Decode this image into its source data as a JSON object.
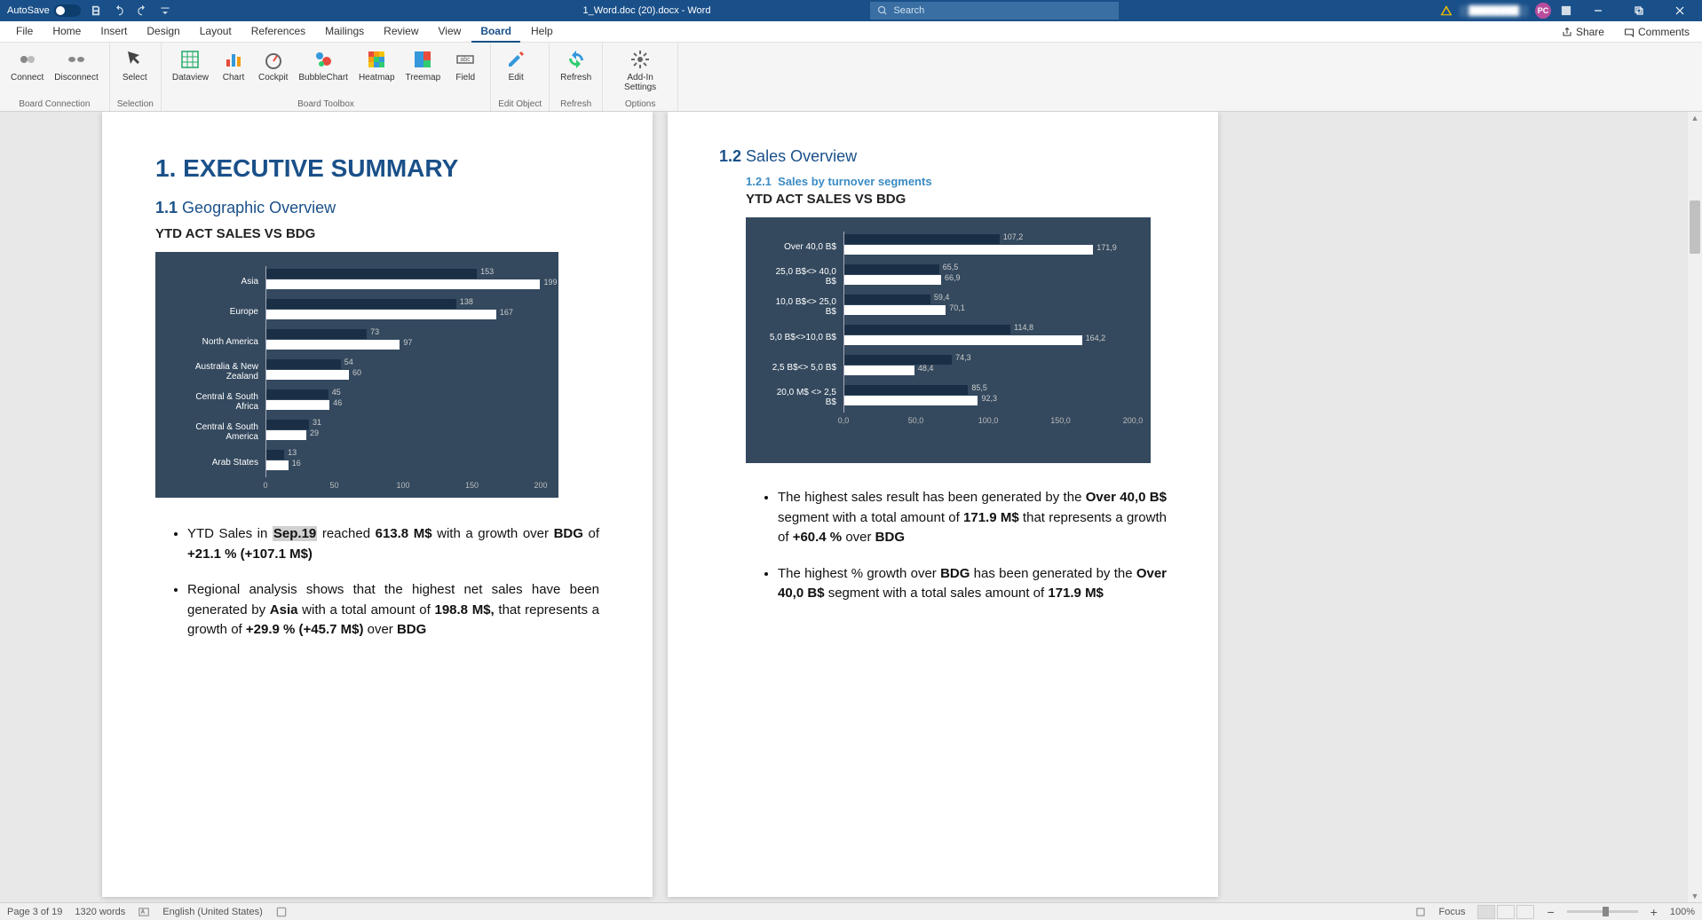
{
  "titlebar": {
    "autosave_label": "AutoSave",
    "autosave_state": "Off",
    "doc_title": "1_Word.doc (20).docx - Word",
    "search_placeholder": "Search",
    "user_initials": "PC"
  },
  "menubar": {
    "tabs": [
      "File",
      "Home",
      "Insert",
      "Design",
      "Layout",
      "References",
      "Mailings",
      "Review",
      "View",
      "Board",
      "Help"
    ],
    "active_tab": "Board",
    "share": "Share",
    "comments": "Comments"
  },
  "ribbon": {
    "groups": [
      {
        "label": "Board Connection",
        "items": [
          "Connect",
          "Disconnect"
        ]
      },
      {
        "label": "Selection",
        "items": [
          "Select"
        ]
      },
      {
        "label": "Board Toolbox",
        "items": [
          "Dataview",
          "Chart",
          "Cockpit",
          "BubbleChart",
          "Heatmap",
          "Treemap",
          "Field"
        ]
      },
      {
        "label": "Edit Object",
        "items": [
          "Edit"
        ]
      },
      {
        "label": "Refresh",
        "items": [
          "Refresh"
        ]
      },
      {
        "label": "Options",
        "items": [
          "Add-In Settings"
        ]
      }
    ]
  },
  "doc": {
    "h1_num": "1.",
    "h1_txt": "EXECUTIVE SUMMARY",
    "sec11_num": "1.1",
    "sec11_txt": "Geographic Overview",
    "chart1_title": "YTD ACT SALES VS BDG",
    "sec12_num": "1.2",
    "sec12_txt": "Sales Overview",
    "sec121_num": "1.2.1",
    "sec121_txt": "Sales by turnover segments",
    "chart2_title": "YTD ACT SALES VS BDG",
    "b1_p1": "YTD Sales in  ",
    "b1_p2": "Sep.19",
    "b1_p3": " reached ",
    "b1_p4": "613.8 M$",
    "b1_p5": " with a growth over ",
    "b1_p6": "BDG",
    "b1_p7": " of ",
    "b1_p8": "+21.1 % (+107.1 M$)",
    "b2_p1": "Regional analysis shows that the highest net sales have been generated by ",
    "b2_p2": "Asia",
    "b2_p3": " with a total amount of ",
    "b2_p4": "198.8 M$,",
    "b2_p5": " that represents a growth of  ",
    "b2_p6": "+29.9 % (+45.7 M$)",
    "b2_p7": " over ",
    "b2_p8": "BDG",
    "r1_p1": "The highest sales result has been generated by the ",
    "r1_p2": "Over 40,0 B$",
    "r1_p3": " segment with a total amount of ",
    "r1_p4": "171.9 M$",
    "r1_p5": " that represents a growth of ",
    "r1_p6": "+60.4 %",
    "r1_p7": " over ",
    "r1_p8": "BDG",
    "r2_p1": "The highest % growth over ",
    "r2_p2": "BDG",
    "r2_p3": " has been generated by the ",
    "r2_p4": "Over 40,0 B$",
    "r2_p5": " segment with a total sales amount of ",
    "r2_p6": "171.9 M$"
  },
  "chart_data": [
    {
      "type": "bar",
      "orientation": "horizontal",
      "categories": [
        "Asia",
        "Europe",
        "North America",
        "Australia & New Zealand",
        "Central & South Africa",
        "Central & South America",
        "Arab States"
      ],
      "series": [
        {
          "name": "BDG",
          "color": "#1a2f45",
          "values": [
            153,
            138,
            73,
            54,
            45,
            31,
            13
          ]
        },
        {
          "name": "ACT",
          "color": "#ffffff",
          "values": [
            199,
            167,
            97,
            60,
            46,
            29,
            16
          ]
        }
      ],
      "xlim": [
        0,
        200
      ],
      "x_ticks": [
        0,
        50,
        100,
        150,
        200
      ],
      "title": "YTD ACT SALES VS BDG"
    },
    {
      "type": "bar",
      "orientation": "horizontal",
      "categories": [
        "Over 40,0 B$",
        "25,0 B$<> 40,0 B$",
        "10,0 B$<> 25,0 B$",
        "5,0 B$<>10,0 B$",
        "2,5 B$<> 5,0 B$",
        "20,0 M$ <> 2,5 B$"
      ],
      "series": [
        {
          "name": "BDG",
          "color": "#1a2f45",
          "values": [
            107.2,
            65.5,
            59.4,
            114.8,
            74.3,
            85.5
          ]
        },
        {
          "name": "ACT",
          "color": "#ffffff",
          "values": [
            171.9,
            66.9,
            70.1,
            164.2,
            48.4,
            92.3
          ]
        }
      ],
      "xlim": [
        0,
        200
      ],
      "x_ticks": [
        0.0,
        50.0,
        100.0,
        150.0,
        200.0
      ],
      "x_tick_labels": [
        "0,0",
        "50,0",
        "100,0",
        "150,0",
        "200,0"
      ],
      "title": "YTD ACT SALES VS BDG"
    }
  ],
  "statusbar": {
    "page": "Page 3 of 19",
    "words": "1320 words",
    "lang": "English (United States)",
    "focus": "Focus",
    "zoom": "100%"
  }
}
